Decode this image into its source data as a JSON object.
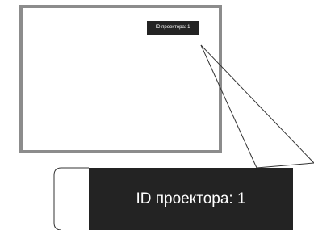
{
  "osd": {
    "label": "ID проектора:",
    "value": "1"
  }
}
